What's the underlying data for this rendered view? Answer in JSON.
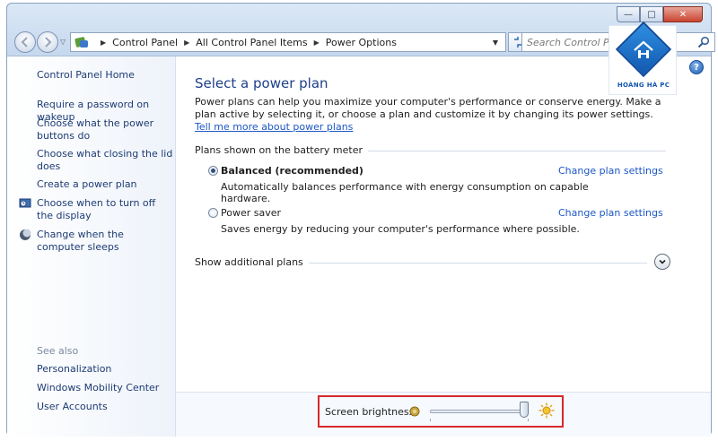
{
  "window": {
    "caption_minimize": "—",
    "caption_maximize": "□",
    "caption_close": "✕"
  },
  "address_bar": {
    "breadcrumbs": [
      "Control Panel",
      "All Control Panel Items",
      "Power Options"
    ],
    "icon": "control-panel-icon"
  },
  "search": {
    "placeholder": "Search Control Panel"
  },
  "sidebar": {
    "home": "Control Panel Home",
    "tasks": [
      {
        "label": "Require a password on wakeup",
        "icon": ""
      },
      {
        "label": "Choose what the power buttons do",
        "icon": ""
      },
      {
        "label": "Choose what closing the lid does",
        "icon": ""
      },
      {
        "label": "Create a power plan",
        "icon": ""
      },
      {
        "label": "Choose when to turn off the display",
        "icon": "display-clock-icon"
      },
      {
        "label": "Change when the computer sleeps",
        "icon": "moon-icon"
      }
    ],
    "see_also_label": "See also",
    "see_also": [
      "Personalization",
      "Windows Mobility Center",
      "User Accounts"
    ]
  },
  "main": {
    "title": "Select a power plan",
    "intro_text": "Power plans can help you maximize your computer's performance or conserve energy. Make a plan active by selecting it, or choose a plan and customize it by changing its power settings.",
    "intro_link": "Tell me more about power plans",
    "group_label": "Plans shown on the battery meter",
    "plans": [
      {
        "name": "Balanced (recommended)",
        "description": "Automatically balances performance with energy consumption on capable hardware.",
        "link": "Change plan settings",
        "selected": true
      },
      {
        "name": "Power saver",
        "description": "Saves energy by reducing your computer's performance where possible.",
        "link": "Change plan settings",
        "selected": false
      }
    ],
    "additional_plans": "Show additional plans",
    "help": "?"
  },
  "brightness": {
    "label": "Screen brightness:",
    "level": 1.0
  },
  "watermark": {
    "text": "HOÀNG HÀ PC"
  },
  "colors": {
    "link": "#1c57c4",
    "title": "#1e3f8a",
    "highlight_box": "#d62a2a"
  }
}
